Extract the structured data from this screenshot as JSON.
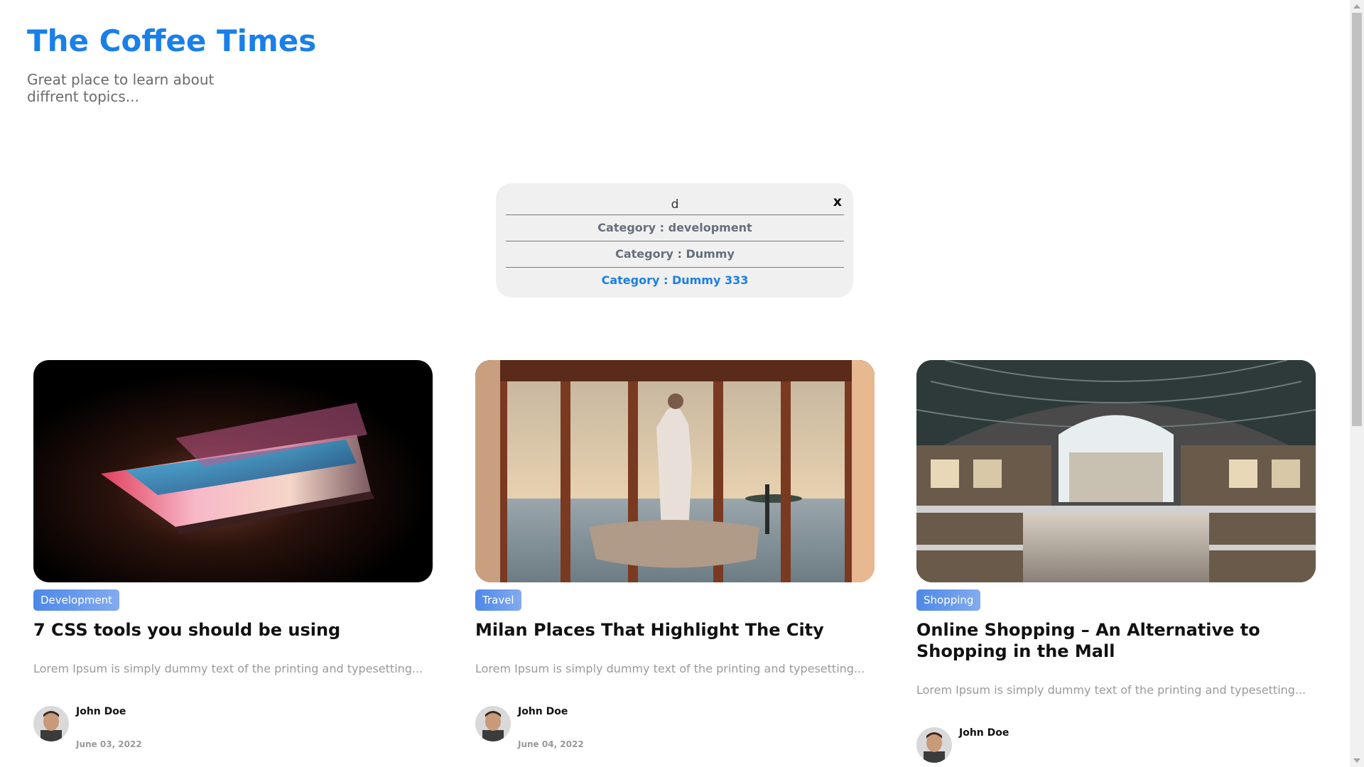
{
  "header": {
    "title": "The Coffee Times",
    "tagline": "Great place to learn about diffrent topics..."
  },
  "search": {
    "value": "d",
    "clear_label": "x",
    "suggestions": [
      "Category : development",
      "Category : Dummy",
      "Category : Dummy 333"
    ]
  },
  "cards": [
    {
      "category": "Development",
      "title": "7 CSS tools you should be using",
      "excerpt": "Lorem Ipsum is simply dummy text of the printing and typesetting...",
      "author": "John Doe",
      "date": "June 03, 2022"
    },
    {
      "category": "Travel",
      "title": "Milan Places That Highlight The City",
      "excerpt": "Lorem Ipsum is simply dummy text of the printing and typesetting...",
      "author": "John Doe",
      "date": "June 04, 2022"
    },
    {
      "category": "Shopping",
      "title": "Online Shopping – An Alternative to Shopping in the Mall",
      "excerpt": "Lorem Ipsum is simply dummy text of the printing and typesetting...",
      "author": "John Doe",
      "date": ""
    }
  ],
  "colors": {
    "accent": "#1a7fe8",
    "badge": "#5b8fe6"
  }
}
